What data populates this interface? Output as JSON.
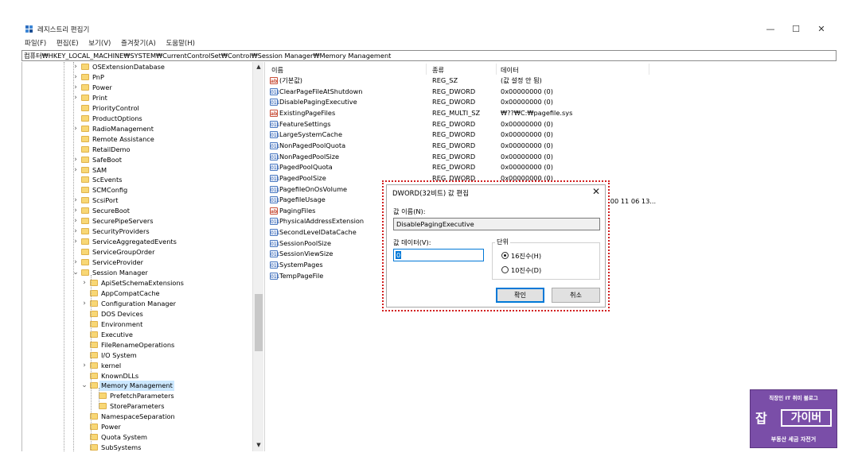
{
  "window": {
    "title": "레지스트리 편집기",
    "minimize_glyph": "—",
    "maximize_glyph": "☐",
    "close_glyph": "✕"
  },
  "menu": [
    "파일(F)",
    "편집(E)",
    "보기(V)",
    "즐겨찾기(A)",
    "도움말(H)"
  ],
  "address": "컴퓨터₩HKEY_LOCAL_MACHINE₩SYSTEM₩CurrentControlSet₩Control₩Session Manager₩Memory Management",
  "tree": {
    "items": [
      {
        "label": "OSExtensionDatabase",
        "chev": ">"
      },
      {
        "label": "PnP",
        "chev": ">"
      },
      {
        "label": "Power",
        "chev": ">"
      },
      {
        "label": "Print",
        "chev": ">"
      },
      {
        "label": "PriorityControl",
        "chev": ""
      },
      {
        "label": "ProductOptions",
        "chev": ""
      },
      {
        "label": "RadioManagement",
        "chev": ">"
      },
      {
        "label": "Remote Assistance",
        "chev": ""
      },
      {
        "label": "RetailDemo",
        "chev": ""
      },
      {
        "label": "SafeBoot",
        "chev": ">"
      },
      {
        "label": "SAM",
        "chev": ">"
      },
      {
        "label": "ScEvents",
        "chev": ""
      },
      {
        "label": "SCMConfig",
        "chev": ""
      },
      {
        "label": "ScsiPort",
        "chev": ">"
      },
      {
        "label": "SecureBoot",
        "chev": ">"
      },
      {
        "label": "SecurePipeServers",
        "chev": ">"
      },
      {
        "label": "SecurityProviders",
        "chev": ">"
      },
      {
        "label": "ServiceAggregatedEvents",
        "chev": ">"
      },
      {
        "label": "ServiceGroupOrder",
        "chev": ""
      },
      {
        "label": "ServiceProvider",
        "chev": ">"
      },
      {
        "label": "Session Manager",
        "chev": "v"
      }
    ],
    "children": [
      {
        "label": "ApiSetSchemaExtensions",
        "chev": ">"
      },
      {
        "label": "AppCompatCache",
        "chev": ""
      },
      {
        "label": "Configuration Manager",
        "chev": ">"
      },
      {
        "label": "DOS Devices",
        "chev": ""
      },
      {
        "label": "Environment",
        "chev": ""
      },
      {
        "label": "Executive",
        "chev": ""
      },
      {
        "label": "FileRenameOperations",
        "chev": ""
      },
      {
        "label": "I/O System",
        "chev": ""
      },
      {
        "label": "kernel",
        "chev": ">"
      },
      {
        "label": "KnownDLLs",
        "chev": ""
      },
      {
        "label": "Memory Management",
        "chev": "v"
      }
    ],
    "grandchildren": [
      {
        "label": "PrefetchParameters"
      },
      {
        "label": "StoreParameters"
      }
    ],
    "after": [
      {
        "label": "NamespaceSeparation"
      },
      {
        "label": "Power"
      },
      {
        "label": "Quota System"
      },
      {
        "label": "SubSystems"
      }
    ],
    "scroll_up": "▲",
    "scroll_down": "▼"
  },
  "list": {
    "columns": [
      "이름",
      "종류",
      "데이터"
    ],
    "rows": [
      {
        "icon": "ab",
        "kind": "sz",
        "name": "(기본값)",
        "type": "REG_SZ",
        "data": "(값 설정 안 됨)"
      },
      {
        "icon": "011",
        "kind": "bin",
        "name": "ClearPageFileAtShutdown",
        "type": "REG_DWORD",
        "data": "0x00000000 (0)"
      },
      {
        "icon": "011",
        "kind": "bin",
        "name": "DisablePagingExecutive",
        "type": "REG_DWORD",
        "data": "0x00000000 (0)"
      },
      {
        "icon": "ab",
        "kind": "sz",
        "name": "ExistingPageFiles",
        "type": "REG_MULTI_SZ",
        "data": "₩??₩C:₩pagefile.sys"
      },
      {
        "icon": "011",
        "kind": "bin",
        "name": "FeatureSettings",
        "type": "REG_DWORD",
        "data": "0x00000000 (0)"
      },
      {
        "icon": "011",
        "kind": "bin",
        "name": "LargeSystemCache",
        "type": "REG_DWORD",
        "data": "0x00000000 (0)"
      },
      {
        "icon": "011",
        "kind": "bin",
        "name": "NonPagedPoolQuota",
        "type": "REG_DWORD",
        "data": "0x00000000 (0)"
      },
      {
        "icon": "011",
        "kind": "bin",
        "name": "NonPagedPoolSize",
        "type": "REG_DWORD",
        "data": "0x00000000 (0)"
      },
      {
        "icon": "011",
        "kind": "bin",
        "name": "PagedPoolQuota",
        "type": "REG_DWORD",
        "data": "0x00000000 (0)"
      },
      {
        "icon": "011",
        "kind": "bin",
        "name": "PagedPoolSize",
        "type": "REG_DWORD",
        "data": "0x00000000 (0)"
      },
      {
        "icon": "011",
        "kind": "bin",
        "name": "PagefileOnOsVolume",
        "type": "",
        "data": ""
      },
      {
        "icon": "011",
        "kind": "bin",
        "name": "PagefileUsage",
        "type": "",
        "data": ""
      },
      {
        "icon": "ab",
        "kind": "sz",
        "name": "PagingFiles",
        "type": "",
        "data": ""
      },
      {
        "icon": "011",
        "kind": "bin",
        "name": "PhysicalAddressExtension",
        "type": "",
        "data": ""
      },
      {
        "icon": "011",
        "kind": "bin",
        "name": "SecondLevelDataCache",
        "type": "",
        "data": ""
      },
      {
        "icon": "011",
        "kind": "bin",
        "name": "SessionPoolSize",
        "type": "",
        "data": ""
      },
      {
        "icon": "011",
        "kind": "bin",
        "name": "SessionViewSize",
        "type": "",
        "data": ""
      },
      {
        "icon": "011",
        "kind": "bin",
        "name": "SystemPages",
        "type": "",
        "data": ""
      },
      {
        "icon": "011",
        "kind": "bin",
        "name": "TempPageFile",
        "type": "",
        "data": ""
      }
    ],
    "overflow_data": "0 00 11 06 13..."
  },
  "dialog": {
    "title": "DWORD(32비트) 값 편집",
    "close_glyph": "✕",
    "name_label": "값 이름(N):",
    "name_value": "DisablePagingExecutive",
    "data_label": "값 데이터(V):",
    "data_value": "0",
    "base_label": "단위",
    "hex_label": "16진수(H)",
    "dec_label": "10진수(D)",
    "ok_label": "확인",
    "cancel_label": "취소"
  },
  "watermark": {
    "top": "직장인 IT 취미 블로그",
    "logo_left": "잡",
    "logo_right": "가이버",
    "bottom": "부동산 세금 자전거"
  }
}
